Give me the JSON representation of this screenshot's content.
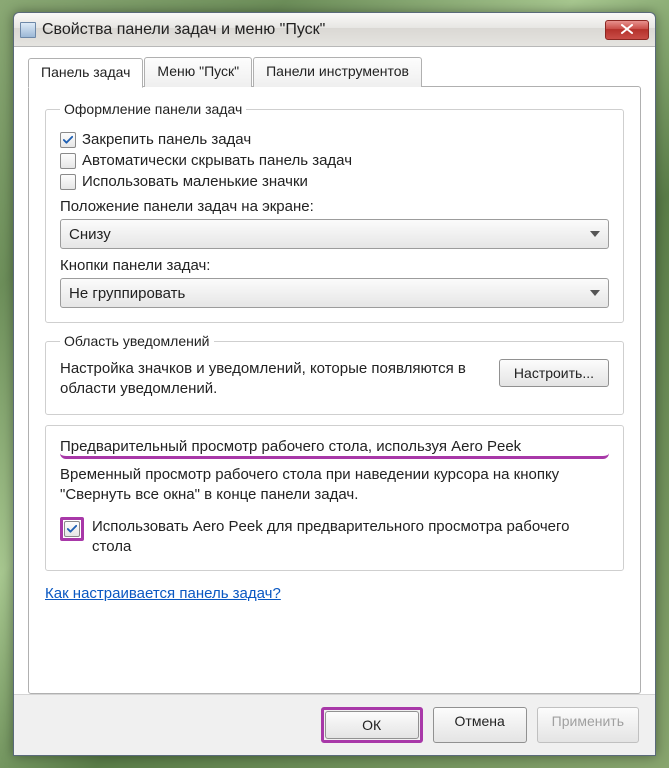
{
  "window": {
    "title": "Свойства панели задач и меню \"Пуск\""
  },
  "tabs": {
    "taskbar": "Панель задач",
    "startmenu": "Меню \"Пуск\"",
    "toolbars": "Панели инструментов"
  },
  "appearance": {
    "legend": "Оформление панели задач",
    "lock": "Закрепить панель задач",
    "autohide": "Автоматически скрывать панель задач",
    "smallicons": "Использовать маленькие значки",
    "position_label": "Положение панели задач на экране:",
    "position_value": "Снизу",
    "buttons_label": "Кнопки панели задач:",
    "buttons_value": "Не группировать"
  },
  "notify": {
    "legend": "Область уведомлений",
    "text": "Настройка значков и уведомлений, которые появляются в области уведомлений.",
    "button": "Настроить..."
  },
  "peek": {
    "title": "Предварительный просмотр рабочего стола, используя Aero Peek",
    "desc": "Временный просмотр рабочего стола при наведении курсора на кнопку \"Свернуть все окна\" в конце панели задач.",
    "checkbox": "Использовать Aero Peek для предварительного просмотра рабочего стола"
  },
  "help_link": "Как настраивается панель задач?",
  "buttons": {
    "ok": "ОК",
    "cancel": "Отмена",
    "apply": "Применить"
  }
}
